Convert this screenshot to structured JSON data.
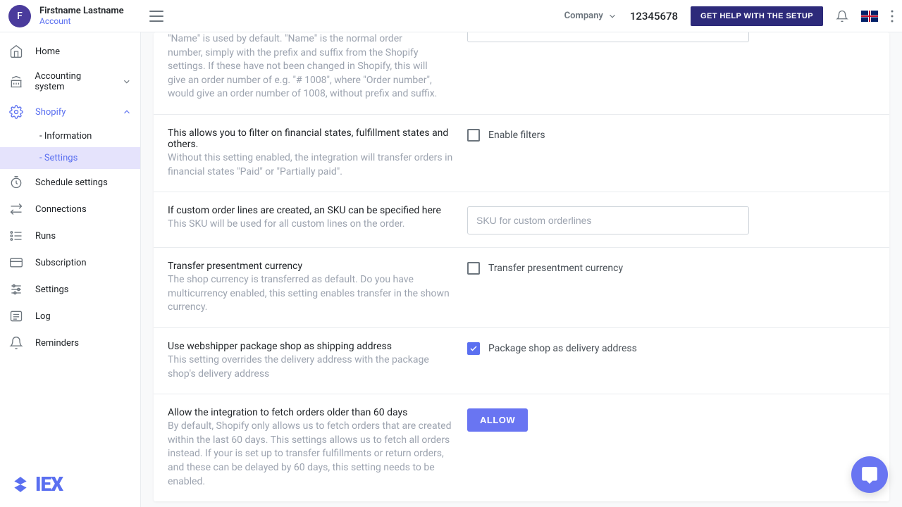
{
  "header": {
    "avatar_initial": "F",
    "user_name": "Firstname Lastname",
    "account_link": "Account",
    "company_label": "Company",
    "company_id": "12345678",
    "help_button": "GET HELP WITH THE SETUP"
  },
  "sidebar": {
    "items": [
      {
        "label": "Home"
      },
      {
        "label": "Accounting system"
      },
      {
        "label": "Shopify"
      },
      {
        "label": "Schedule settings"
      },
      {
        "label": "Connections"
      },
      {
        "label": "Runs"
      },
      {
        "label": "Subscription"
      },
      {
        "label": "Settings"
      },
      {
        "label": "Log"
      },
      {
        "label": "Reminders"
      }
    ],
    "sub_items": [
      {
        "label": "- Information"
      },
      {
        "label": "- Settings"
      }
    ],
    "logo_text": "IEX"
  },
  "settings": {
    "partial_top_desc": "\"Name\" is used by default. \"Name\" is the normal order number, simply with the prefix and suffix from the Shopify settings. If these have not been changed in Shopify, this will give an order number of e.g. \"# 1008\", where \"Order number\", would give an order number of 1008, without prefix and suffix.",
    "rows": [
      {
        "title": "This allows you to filter on financial states, fulfillment states and others.",
        "desc": "Without this setting enabled, the integration will transfer orders in financial states \"Paid\" or \"Partially paid\".",
        "control_label": "Enable filters",
        "checked": false
      },
      {
        "title": "If custom order lines are created, an SKU can be specified here",
        "desc": "This SKU will be used for all custom lines on the order.",
        "placeholder": "SKU for custom orderlines"
      },
      {
        "title": "Transfer presentment currency",
        "desc": "The shop currency is transferred as default. Do you have multicurrency enabled, this setting enables transfer in the shown currency.",
        "control_label": "Transfer presentment currency",
        "checked": false
      },
      {
        "title": "Use webshipper package shop as shipping address",
        "desc": "This setting overrides the delivery address with the package shop's delivery address",
        "control_label": "Package shop as delivery address",
        "checked": true
      },
      {
        "title": "Allow the integration to fetch orders older than 60 days",
        "desc": "By default, Shopify only allows us to fetch orders that are created within the last 60 days. This settings allows us to fetch all orders instead. If your is set up to transfer fulfillments or return orders, and these can be delayed by 60 days, this setting needs to be enabled.",
        "button_label": "ALLOW"
      }
    ]
  }
}
